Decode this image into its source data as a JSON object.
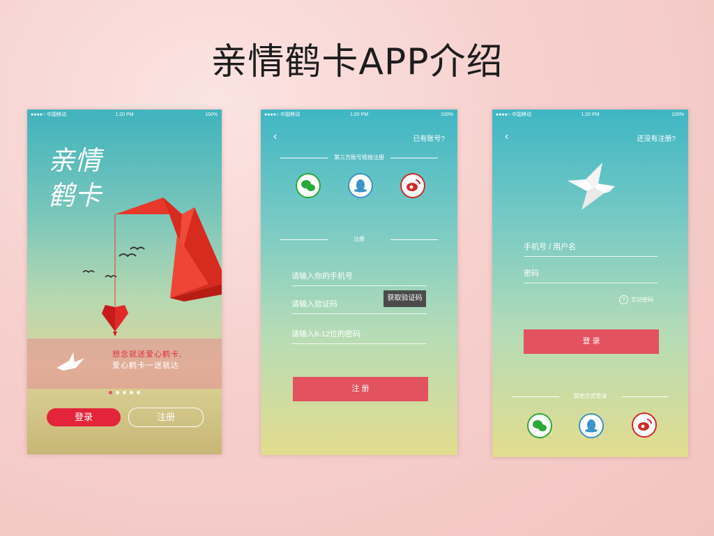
{
  "slide": {
    "title": "亲情鹤卡APP介绍"
  },
  "status_bar": {
    "carrier": "●●●●○ 中国移动",
    "time": "1:20 PM",
    "battery": "100%"
  },
  "screen1": {
    "logo_line1": "亲情",
    "logo_line2": "鹤卡",
    "banner_line1": "想念就送爱心鹤卡,",
    "banner_line2": "爱心鹤卡一送就达",
    "login_button": "登录",
    "register_button": "注册",
    "page_indicator": {
      "count": 5,
      "active": 1
    },
    "colors": {
      "primary": "#e2525f",
      "crane": "#e8372b"
    }
  },
  "screen2": {
    "top_link": "已有账号?",
    "third_party_label": "第三方账号链接注册",
    "register_label": "注册",
    "phone_placeholder": "请输入你的手机号",
    "code_placeholder": "请输入验证码",
    "get_code_button": "获取验证码",
    "password_placeholder": "请输入6-12位的密码",
    "submit_button": "注 册",
    "social_icons": [
      "wechat-icon",
      "qq-icon",
      "weibo-icon"
    ]
  },
  "screen3": {
    "top_link": "还没有注册?",
    "username_placeholder": "手机号 / 用户名",
    "password_placeholder": "密码",
    "forgot_password": "忘记密码",
    "login_button": "登 录",
    "other_login_label": "其他方式登录",
    "social_icons": [
      "wechat-icon",
      "qq-icon",
      "weibo-icon"
    ]
  }
}
